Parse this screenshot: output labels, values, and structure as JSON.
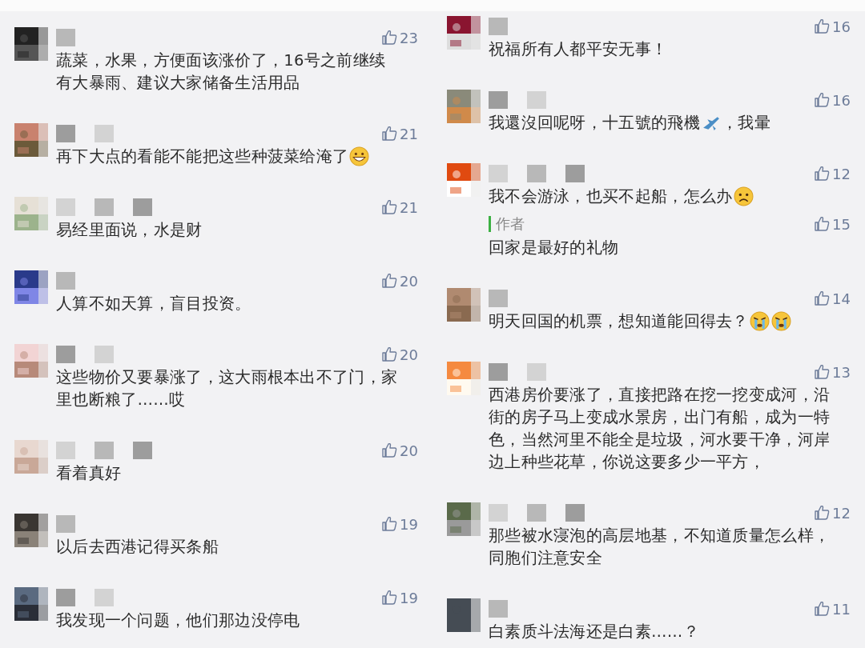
{
  "columns": [
    {
      "comments": [
        {
          "likes": "23",
          "content": [
            {
              "kind": "text",
              "text": "蔬菜，水果，方便面该涨价了，16号之前继续有大暴雨、建议大家储备生活用品"
            }
          ]
        },
        {
          "likes": "21",
          "content": [
            {
              "kind": "text",
              "text": "再下大点的看能不能把这些种菠菜给淹了"
            },
            {
              "kind": "grin"
            }
          ]
        },
        {
          "likes": "21",
          "content": [
            {
              "kind": "text",
              "text": "易经里面说，水是财"
            }
          ]
        },
        {
          "likes": "20",
          "content": [
            {
              "kind": "text",
              "text": "人算不如天算，盲目投资。"
            }
          ]
        },
        {
          "likes": "20",
          "content": [
            {
              "kind": "text",
              "text": "这些物价又要暴涨了，这大雨根本出不了门，家里也断粮了……哎"
            }
          ]
        },
        {
          "likes": "20",
          "content": [
            {
              "kind": "text",
              "text": "看着真好"
            }
          ]
        },
        {
          "likes": "19",
          "content": [
            {
              "kind": "text",
              "text": "以后去西港记得买条船"
            }
          ]
        },
        {
          "likes": "19",
          "content": [
            {
              "kind": "text",
              "text": "我发现一个问题，他们那边没停电"
            }
          ]
        }
      ]
    },
    {
      "comments": [
        {
          "likes": "16",
          "content": [
            {
              "kind": "text",
              "text": "祝福所有人都平安无事！"
            }
          ]
        },
        {
          "likes": "16",
          "content": [
            {
              "kind": "text",
              "text": "我還沒回呢呀，十五號的飛機"
            },
            {
              "kind": "plane"
            },
            {
              "kind": "text",
              "text": "，我暈"
            }
          ]
        },
        {
          "likes": "12",
          "content": [
            {
              "kind": "text",
              "text": "我不会游泳，也买不起船，怎么办"
            },
            {
              "kind": "frown"
            }
          ],
          "reply": {
            "label": "作者",
            "likes": "15",
            "content": [
              {
                "kind": "text",
                "text": "回家是最好的礼物"
              }
            ]
          }
        },
        {
          "likes": "14",
          "content": [
            {
              "kind": "text",
              "text": "明天回国的机票，想知道能回得去？"
            },
            {
              "kind": "crying"
            },
            {
              "kind": "crying"
            }
          ]
        },
        {
          "likes": "13",
          "content": [
            {
              "kind": "text",
              "text": "西港房价要涨了，直接把路在挖一挖变成河，沿街的房子马上变成水景房，出门有船，成为一特色，当然河里不能全是垃圾，河水要干净，河岸边上种些花草，你说这要多少一平方，"
            }
          ]
        },
        {
          "likes": "12",
          "content": [
            {
              "kind": "text",
              "text": "那些被水寖泡的高层地基，不知道质量怎么样，同胞们注意安全"
            }
          ]
        },
        {
          "likes": "11",
          "content": [
            {
              "kind": "text",
              "text": "白素质斗法海还是白素……？"
            }
          ]
        }
      ]
    }
  ]
}
